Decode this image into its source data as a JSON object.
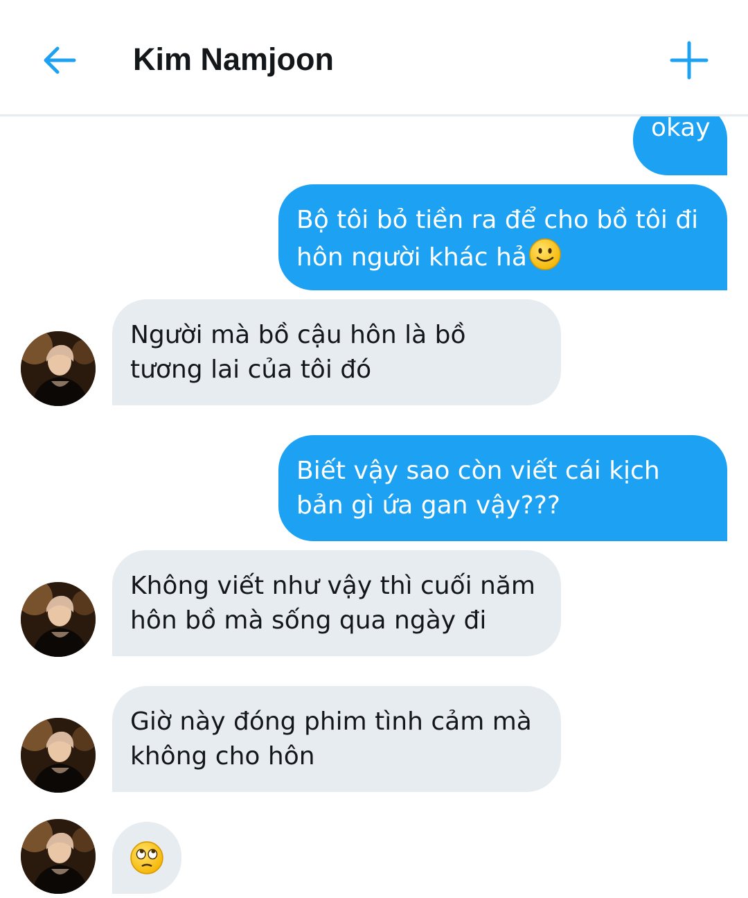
{
  "header": {
    "title": "Kim Namjoon",
    "back_icon": "arrow-left-icon",
    "action_icon": "plus-icon",
    "accent_color": "#1da1f2"
  },
  "messages": [
    {
      "direction": "sent",
      "lines": [
        "okay"
      ]
    },
    {
      "direction": "sent",
      "lines": [
        "Bộ tôi bỏ tiền ra để cho bồ tôi đi",
        "hôn người khác hả"
      ],
      "emoji": "slightly-smiling-face"
    },
    {
      "direction": "received",
      "lines": [
        "Người mà bồ cậu hôn là bồ",
        "tương lai của tôi đó"
      ]
    },
    {
      "direction": "sent",
      "lines": [
        "Biết vậy sao còn viết cái kịch",
        "bản gì ứa gan vậy???"
      ]
    },
    {
      "direction": "received",
      "lines": [
        "Không viết như vậy thì cuối năm",
        "hôn bồ mà sống qua ngày đi"
      ]
    },
    {
      "direction": "received",
      "lines": [
        "Giờ này đóng phim tình cảm mà",
        "không cho hôn"
      ]
    },
    {
      "direction": "received",
      "lines": [],
      "emoji": "face-with-rolling-eyes"
    }
  ],
  "colors": {
    "sent_bubble": "#1da1f2",
    "received_bubble": "#e6ecf0",
    "divider": "#e6ecf0"
  }
}
